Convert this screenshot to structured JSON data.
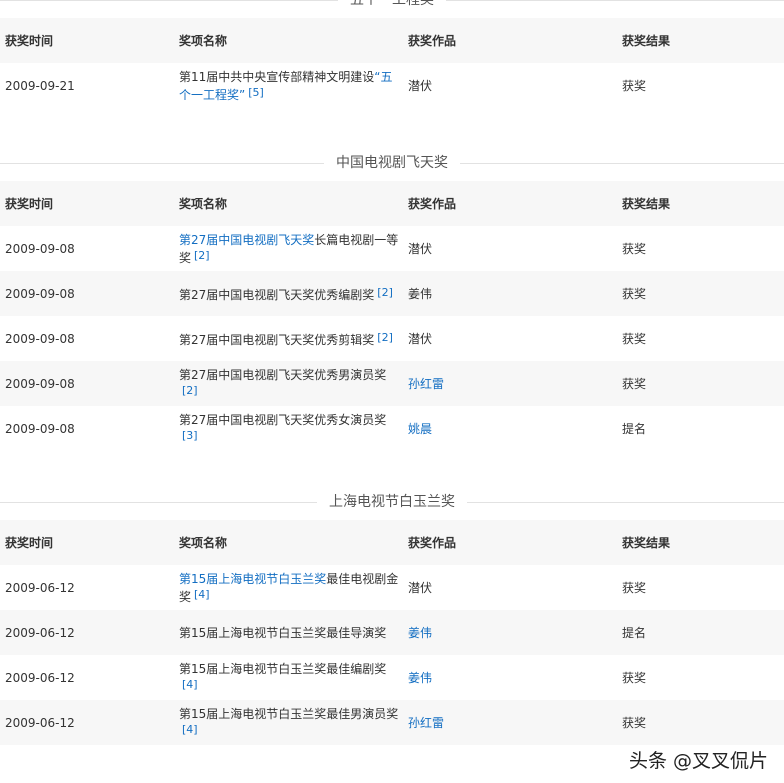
{
  "headers": {
    "time": "获奖时间",
    "award": "奖项名称",
    "work": "获奖作品",
    "result": "获奖结果"
  },
  "sections": [
    {
      "title": "五个一工程奖",
      "rows": [
        {
          "time": "2009-09-21",
          "award_plain": "第11届中共中央宣传部精神文明建设",
          "award_link": "“五个一工程奖”",
          "award_after": "",
          "ref": "[5]",
          "work": "潜伏",
          "work_is_link": false,
          "result": "获奖"
        }
      ]
    },
    {
      "title": "中国电视剧飞天奖",
      "rows": [
        {
          "time": "2009-09-08",
          "award_plain": "",
          "award_link": "第27届中国电视剧飞天奖",
          "award_after": "长篇电视剧一等奖",
          "ref": "[2]",
          "work": "潜伏",
          "work_is_link": false,
          "result": "获奖"
        },
        {
          "time": "2009-09-08",
          "award_plain": "第27届中国电视剧飞天奖优秀编剧奖",
          "award_link": "",
          "award_after": "",
          "ref": "[2]",
          "work": "姜伟",
          "work_is_link": false,
          "result": "获奖"
        },
        {
          "time": "2009-09-08",
          "award_plain": "第27届中国电视剧飞天奖优秀剪辑奖",
          "award_link": "",
          "award_after": "",
          "ref": "[2]",
          "work": "潜伏",
          "work_is_link": false,
          "result": "获奖"
        },
        {
          "time": "2009-09-08",
          "award_plain": "第27届中国电视剧飞天奖优秀男演员奖",
          "award_link": "",
          "award_after": "",
          "ref": "[2]",
          "work": "孙红雷",
          "work_is_link": true,
          "result": "获奖"
        },
        {
          "time": "2009-09-08",
          "award_plain": "第27届中国电视剧飞天奖优秀女演员奖",
          "award_link": "",
          "award_after": "",
          "ref": "[3]",
          "work": "姚晨",
          "work_is_link": true,
          "result": "提名"
        }
      ]
    },
    {
      "title": "上海电视节白玉兰奖",
      "rows": [
        {
          "time": "2009-06-12",
          "award_plain": "",
          "award_link": "第15届上海电视节白玉兰奖",
          "award_after": "最佳电视剧金奖",
          "ref": "[4]",
          "work": "潜伏",
          "work_is_link": false,
          "result": "获奖"
        },
        {
          "time": "2009-06-12",
          "award_plain": "第15届上海电视节白玉兰奖最佳导演奖",
          "award_link": "",
          "award_after": "",
          "ref": "",
          "work": "姜伟",
          "work_is_link": true,
          "result": "提名"
        },
        {
          "time": "2009-06-12",
          "award_plain": "第15届上海电视节白玉兰奖最佳编剧奖",
          "award_link": "",
          "award_after": "",
          "ref": "[4]",
          "work": "姜伟",
          "work_is_link": true,
          "result": "获奖"
        },
        {
          "time": "2009-06-12",
          "award_plain": "第15届上海电视节白玉兰奖最佳男演员奖",
          "award_link": "",
          "award_after": "",
          "ref": "[4]",
          "work": "孙红雷",
          "work_is_link": true,
          "result": "获奖"
        }
      ]
    }
  ],
  "watermark": "头条 @叉叉侃片",
  "colors": {
    "link": "#136ec2",
    "header_bg": "#f7f7f7"
  }
}
